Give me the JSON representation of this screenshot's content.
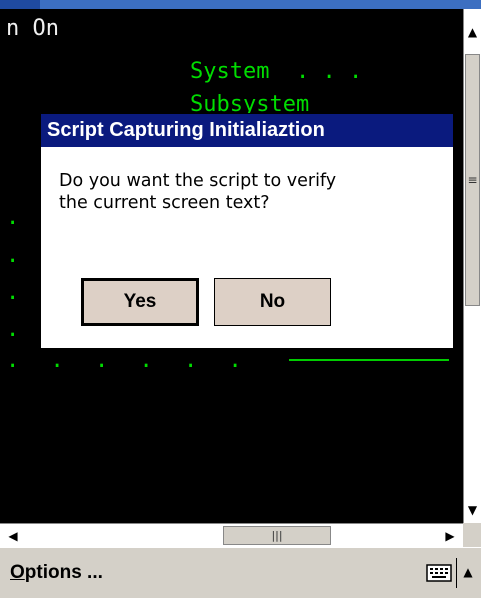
{
  "terminal": {
    "lines": [
      {
        "text": "n On",
        "color": "#f0f0f0"
      },
      {
        "text": "System  . . .",
        "color": "#00dd00"
      },
      {
        "text": "Subsystem",
        "color": "#00dd00"
      },
      {
        "text": ".",
        "color": "#00dd00"
      },
      {
        "text": ".",
        "color": "#00dd00"
      },
      {
        "text": ".",
        "color": "#00dd00"
      },
      {
        "text": ".",
        "color": "#00dd00"
      },
      {
        "text": ". . . . . .",
        "color": "#00dd00"
      }
    ]
  },
  "dialog": {
    "title": "Script Capturing Initialiaztion",
    "message": "Do you want the script to verify the current screen text?",
    "yes_label": "Yes",
    "no_label": "No",
    "title_bar_color": "#0a1a7e"
  },
  "scrollbars": {
    "vertical_thumb_icon": "grip-lines-icon",
    "horizontal_thumb_icon": "grip-lines-icon"
  },
  "menubar": {
    "options_label_underlined": "O",
    "options_label_rest": "ptions ...",
    "keyboard_icon": "keyboard-icon",
    "sip_arrow_icon": "arrow-up-icon"
  },
  "colors": {
    "terminal_text": "#00dd00",
    "terminal_bg": "#000000",
    "button_face": "#ddd0c6"
  }
}
